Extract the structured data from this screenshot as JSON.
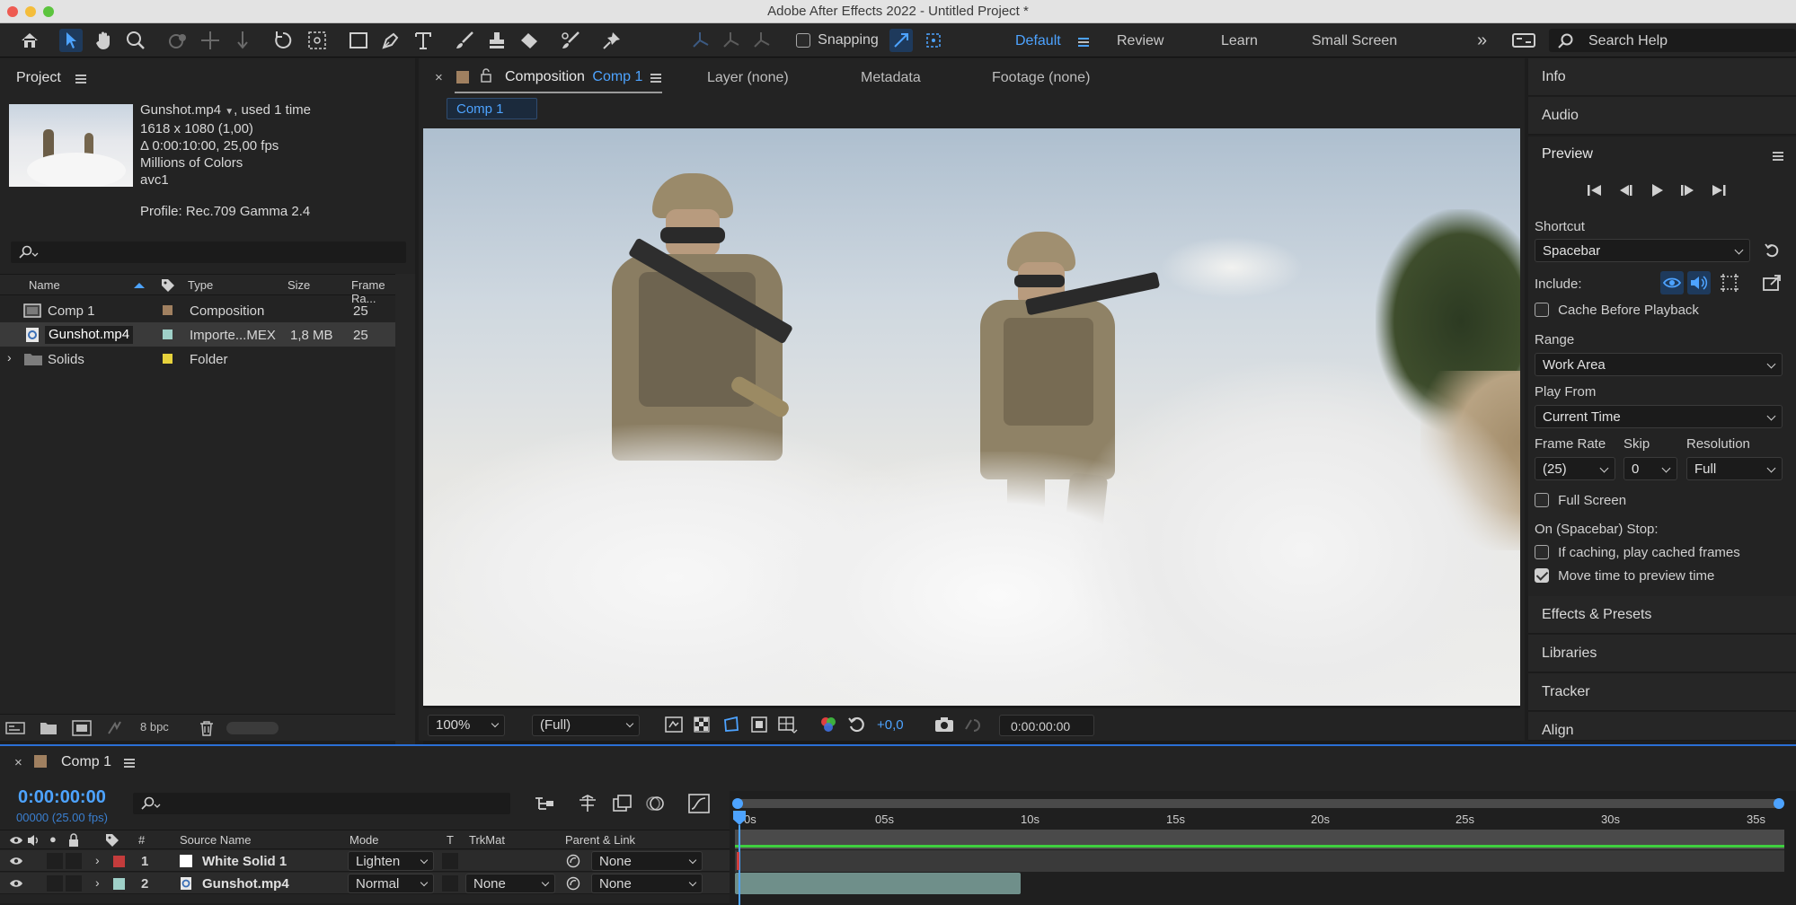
{
  "window": {
    "title": "Adobe After Effects 2022 - Untitled Project *"
  },
  "toolbar": {
    "snapping_label": "Snapping",
    "workspaces": [
      "Default",
      "Review",
      "Learn",
      "Small Screen"
    ],
    "search_placeholder": "Search Help"
  },
  "project": {
    "panel_title": "Project",
    "selected_file": {
      "name": "Gunshot.mp4",
      "usage": ", used 1 time",
      "dimensions": "1618 x 1080 (1,00)",
      "duration": "Δ 0:00:10:00, 25,00 fps",
      "colors": "Millions of Colors",
      "codec": "avc1",
      "profile": "Profile: Rec.709 Gamma 2.4"
    },
    "columns": [
      "Name",
      "Type",
      "Size",
      "Frame Ra..."
    ],
    "items": [
      {
        "name": "Comp 1",
        "label_color": "#a08060",
        "type": "Composition",
        "size": "",
        "frame_rate": "25"
      },
      {
        "name": "Gunshot.mp4",
        "label_color": "#9fd0c8",
        "type": "Importe...MEX",
        "size": "1,8 MB",
        "frame_rate": "25"
      },
      {
        "name": "Solids",
        "label_color": "#e6d23c",
        "type": "Folder",
        "size": "",
        "frame_rate": ""
      }
    ],
    "bpc": "8 bpc"
  },
  "viewer": {
    "tabs": [
      {
        "label": "Composition",
        "comp": "Comp 1"
      },
      {
        "label": "Layer (none)"
      },
      {
        "label": "Metadata"
      },
      {
        "label": "Footage (none)"
      }
    ],
    "breadcrumb": "Comp 1",
    "zoom": "100%",
    "resolution": "(Full)",
    "exposure": "+0,0",
    "timecode": "0:00:00:00"
  },
  "right_panels": {
    "info": "Info",
    "audio": "Audio",
    "preview": "Preview",
    "shortcut_label": "Shortcut",
    "shortcut_value": "Spacebar",
    "include_label": "Include:",
    "cache_before_playback": "Cache Before Playback",
    "range_label": "Range",
    "range_value": "Work Area",
    "play_from_label": "Play From",
    "play_from_value": "Current Time",
    "frame_rate_label": "Frame Rate",
    "frame_rate_value": "(25)",
    "skip_label": "Skip",
    "skip_value": "0",
    "resolution_label": "Resolution",
    "resolution_value": "Full",
    "full_screen": "Full Screen",
    "on_stop_label": "On (Spacebar) Stop:",
    "if_caching": "If caching, play cached frames",
    "move_time": "Move time to preview time",
    "effects_presets": "Effects & Presets",
    "libraries": "Libraries",
    "tracker": "Tracker",
    "align": "Align"
  },
  "timeline": {
    "comp_name": "Comp 1",
    "current_time": "0:00:00:00",
    "frame_info": "00000 (25.00 fps)",
    "columns": {
      "number": "#",
      "source": "Source Name",
      "mode": "Mode",
      "t": "T",
      "trkmat": "TrkMat",
      "parent": "Parent & Link"
    },
    "ruler": [
      "0s",
      "05s",
      "10s",
      "15s",
      "20s",
      "25s",
      "30s",
      "35s"
    ],
    "layers": [
      {
        "num": "1",
        "name": "White Solid 1",
        "label_color": "#c43c3c",
        "mode": "Lighten",
        "trkmat": "",
        "parent": "None"
      },
      {
        "num": "2",
        "name": "Gunshot.mp4",
        "label_color": "#9fd0c8",
        "mode": "Normal",
        "trkmat": "None",
        "parent": "None"
      }
    ]
  }
}
